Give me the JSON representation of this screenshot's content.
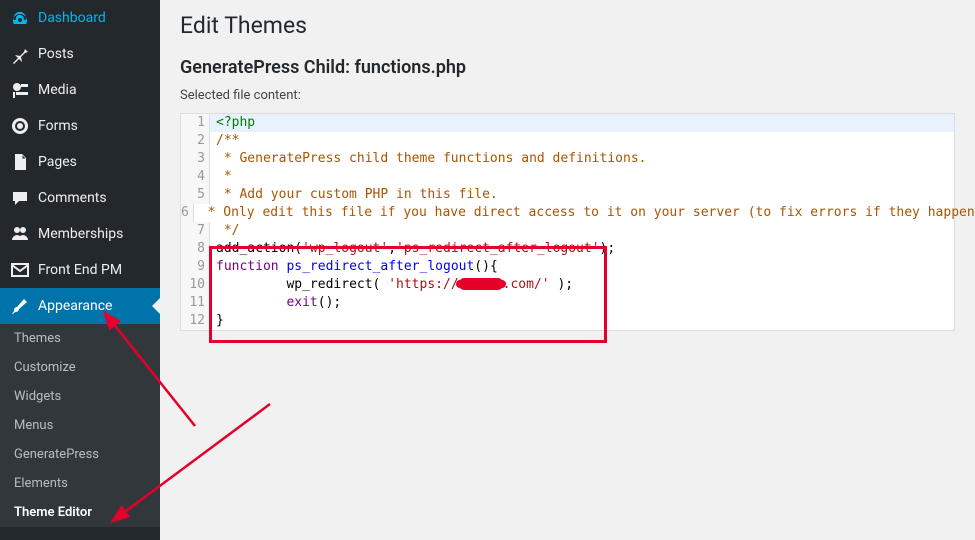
{
  "sidebar": {
    "items": [
      {
        "label": "Dashboard",
        "icon": "dashboard-icon"
      },
      {
        "label": "Posts",
        "icon": "pin-icon"
      },
      {
        "label": "Media",
        "icon": "media-icon"
      },
      {
        "label": "Forms",
        "icon": "forms-icon"
      },
      {
        "label": "Pages",
        "icon": "pages-icon"
      },
      {
        "label": "Comments",
        "icon": "comments-icon"
      },
      {
        "label": "Memberships",
        "icon": "memberships-icon"
      },
      {
        "label": "Front End PM",
        "icon": "envelope-icon"
      },
      {
        "label": "Appearance",
        "icon": "brush-icon",
        "active": true
      }
    ],
    "submenu": [
      {
        "label": "Themes"
      },
      {
        "label": "Customize"
      },
      {
        "label": "Widgets"
      },
      {
        "label": "Menus"
      },
      {
        "label": "GeneratePress"
      },
      {
        "label": "Elements"
      },
      {
        "label": "Theme Editor",
        "current": true
      }
    ]
  },
  "page": {
    "title": "Edit Themes",
    "file_heading": "GeneratePress Child: functions.php",
    "content_label": "Selected file content:"
  },
  "code": {
    "lines": [
      {
        "n": 1,
        "html": "<span class='c-tag'>&lt;?php</span>",
        "hl": true
      },
      {
        "n": 2,
        "html": "<span class='c-cmt'>/**</span>"
      },
      {
        "n": 3,
        "html": "<span class='c-cmt'> * GeneratePress child theme functions and definitions.</span>"
      },
      {
        "n": 4,
        "html": "<span class='c-cmt'> *</span>"
      },
      {
        "n": 5,
        "html": "<span class='c-cmt'> * Add your custom PHP in this file.</span>"
      },
      {
        "n": 6,
        "html": "<span class='c-cmt'> * Only edit this file if you have direct access to it on your server (to fix errors if they happen).</span>"
      },
      {
        "n": 7,
        "html": "<span class='c-cmt'> */</span>"
      },
      {
        "n": 8,
        "html": "<span class='c-fn'>add_action</span>(<span class='c-str'>'wp_logout'</span>,<span class='c-str'>'ps_redirect_after_logout'</span>);"
      },
      {
        "n": 9,
        "html": "<span class='c-kw'>function</span> <span class='c-fname'>ps_redirect_after_logout</span>(){"
      },
      {
        "n": 10,
        "html": "         <span class='c-fn'>wp_redirect</span>( <span class='c-str'>'https://</span><span class='redact'></span><span class='c-str'>.com/'</span> );"
      },
      {
        "n": 11,
        "html": "         <span class='c-kw'>exit</span>();"
      },
      {
        "n": 12,
        "html": "}"
      }
    ]
  }
}
